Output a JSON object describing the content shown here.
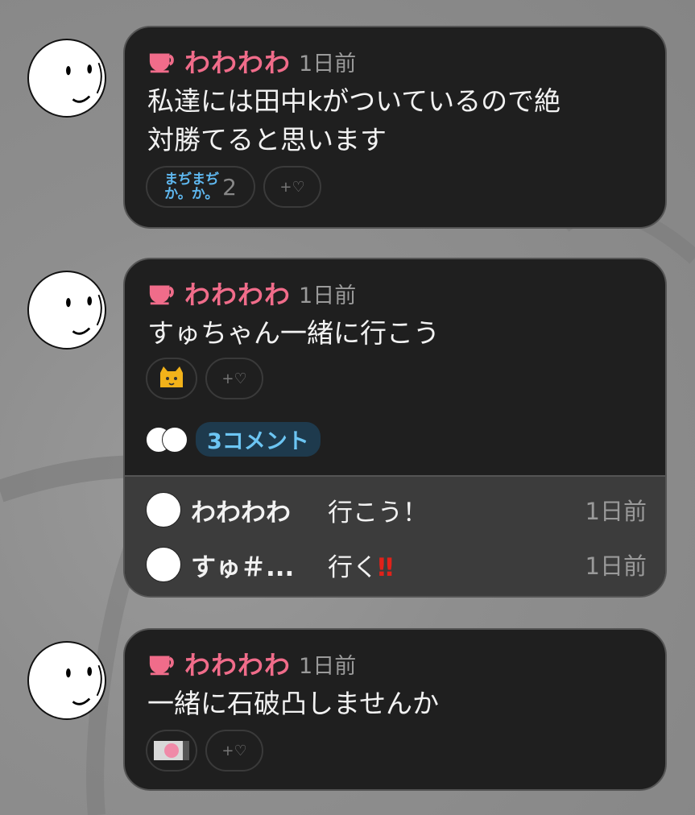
{
  "posts": [
    {
      "user": "わわわわ",
      "time": "1日前",
      "text_lines": [
        "私達には田中kがついているので絶",
        "対勝てると思います"
      ],
      "reaction": {
        "label_line1": "まぢまぢ",
        "label_line2": "か。か。",
        "count": "2"
      },
      "add_reaction": "+♡"
    },
    {
      "user": "わわわわ",
      "time": "1日前",
      "text_lines": [
        "すゅちゃん一緒に行こう"
      ],
      "reaction": {
        "emoji": "cat-emoji"
      },
      "add_reaction": "+♡",
      "comment_badge": "3コメント",
      "comments": [
        {
          "name": "わわわわ",
          "text": "行こう！",
          "time": "1日前"
        },
        {
          "name": "すゅ＃...",
          "text": "行く",
          "emphasis": "‼",
          "time": "1日前"
        }
      ]
    },
    {
      "user": "わわわわ",
      "time": "1日前",
      "text_lines": [
        "一緒に石破凸しませんか"
      ],
      "reaction": {
        "image": "pink-character-image"
      },
      "add_reaction": "+♡"
    }
  ],
  "colors": {
    "username": "#f06c8a",
    "bubble": "#1f1f1f",
    "badge": "#6cc5f3"
  }
}
